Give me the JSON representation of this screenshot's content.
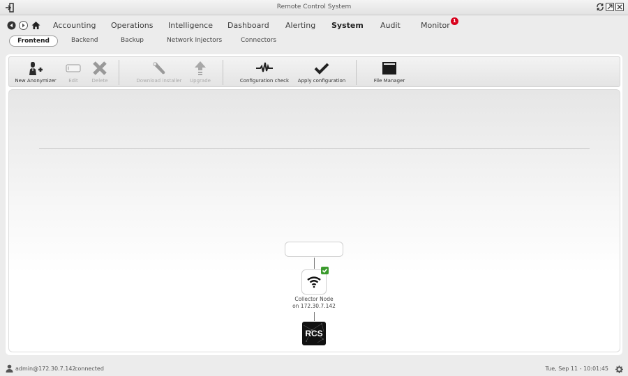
{
  "window": {
    "title": "Remote Control System"
  },
  "main_nav": {
    "items": [
      {
        "label": "Accounting"
      },
      {
        "label": "Operations"
      },
      {
        "label": "Intelligence"
      },
      {
        "label": "Dashboard"
      },
      {
        "label": "Alerting"
      },
      {
        "label": "System",
        "active": true
      },
      {
        "label": "Audit"
      },
      {
        "label": "Monitor",
        "badge": "1"
      }
    ]
  },
  "sub_nav": {
    "tabs": [
      {
        "label": "Frontend",
        "active": true
      },
      {
        "label": "Backend"
      },
      {
        "label": "Backup"
      },
      {
        "label": "Network Injectors"
      },
      {
        "label": "Connectors"
      }
    ]
  },
  "toolbar": {
    "new_anonymizer": "New Anonymizer",
    "edit": "Edit",
    "delete": "Delete",
    "download_installer": "Download installer",
    "upgrade": "Upgrade",
    "configuration_check": "Configuration check",
    "apply_configuration": "Apply configuration",
    "file_manager": "File Manager"
  },
  "topology": {
    "collector_label_line1": "Collector Node",
    "collector_label_line2": "on 172.30.7.142",
    "collector_status": "ok",
    "rcs_label": "RCS"
  },
  "status_bar": {
    "user": "admin@172.30.7.142",
    "connection": "connected",
    "datetime": "Tue, Sep 11 - 10:01:45"
  },
  "colors": {
    "badge": "#d8001c",
    "status_ok": "#3a9a2c",
    "rcs_bg": "#111111"
  }
}
